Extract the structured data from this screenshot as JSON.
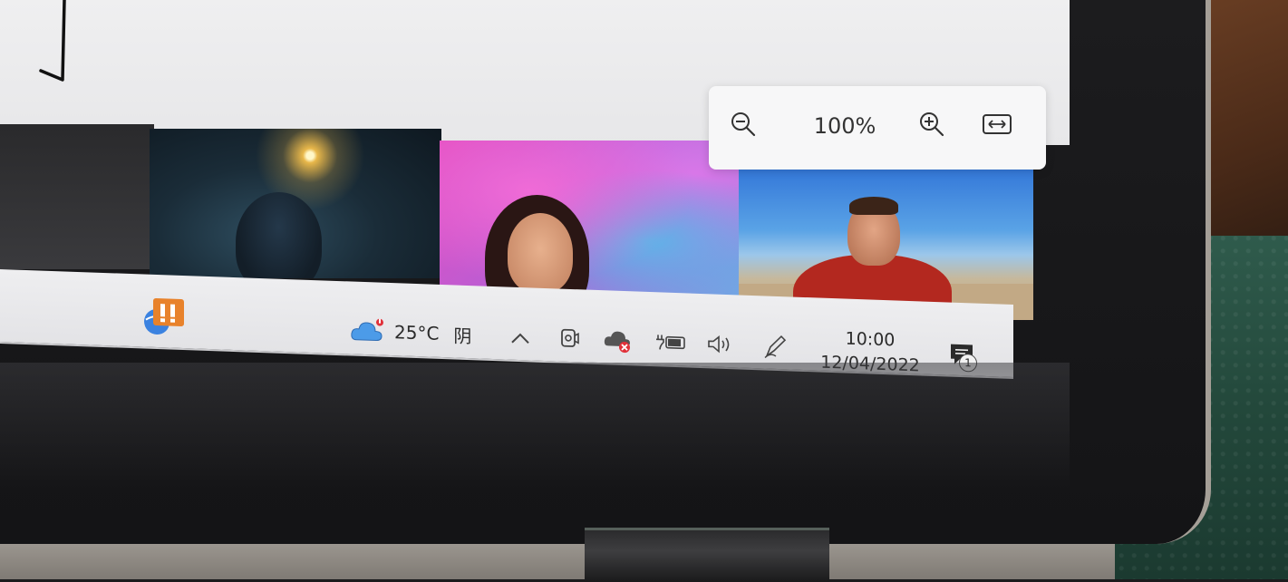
{
  "zoom": {
    "level": "100%",
    "zoom_out_icon": "zoom-out-icon",
    "zoom_in_icon": "zoom-in-icon",
    "fit_width_icon": "fit-width-icon"
  },
  "taskbar": {
    "weather": {
      "temperature": "25°C",
      "condition": "阴",
      "icon": "cloud-weather-icon"
    },
    "tray_icons": [
      "chevron-up-icon",
      "camera-icon",
      "onedrive-error-icon",
      "battery-charging-icon",
      "volume-icon",
      "pen-icon"
    ],
    "clock": {
      "time": "10:00",
      "date": "12/04/2022"
    },
    "notifications": {
      "count": "1",
      "icon": "notification-center-icon"
    }
  },
  "colors": {
    "taskbar_bg": "#eeeef0",
    "app_icon_orange": "#e8822b",
    "error_red": "#e0313a"
  }
}
